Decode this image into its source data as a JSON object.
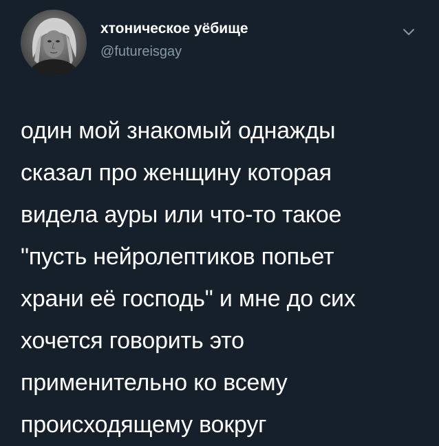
{
  "tweet": {
    "author": {
      "display_name": "хтоническое уёбище",
      "handle": "@futureisgay",
      "avatar_icon": "user-avatar-photo"
    },
    "menu_icon": "chevron-down-icon",
    "text_lines": [
      "один мой знакомый однажды",
      "сказал про женщину которая",
      "видела ауры или что-то такое",
      "\"пусть нейролептиков попьет",
      "храни её господь\" и мне до сих",
      "хочется говорить это",
      "применительно ко всему",
      "происходящему вокруг"
    ]
  },
  "colors": {
    "background": "#15202b",
    "text": "#ffffff",
    "secondary_text": "#8899a6"
  }
}
